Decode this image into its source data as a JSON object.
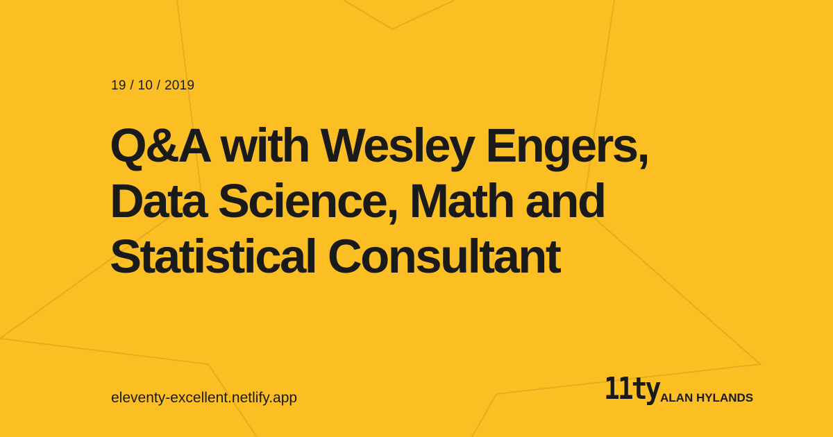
{
  "page": {
    "background_color": "#FBBF24",
    "text_color": "#1a1a1a",
    "outline_color": "#E5AC1F"
  },
  "date": "19 / 10 / 2019",
  "title_lines": [
    "Q&A with Wesley Engers,",
    "Data Science, Math and",
    "Statistical Consultant"
  ],
  "footer": {
    "site": "eleventy-excellent.netlify.app",
    "logo": "11ty",
    "author": "ALAN HYLANDS"
  }
}
